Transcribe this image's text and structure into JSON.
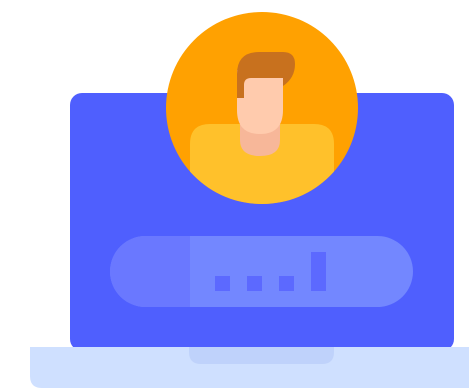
{
  "illustration": {
    "subject": "laptop-user-login",
    "colors": {
      "screen": "#4f5ffe",
      "base": "#cfe0ff",
      "notch": "#bfd2fb",
      "password_field": "#7387ff",
      "password_field_left": "#6a78ff",
      "password_dots": "#5c69ff",
      "avatar_circle": "#ffa101",
      "hair": "#c8711e",
      "face": "#ffcbad",
      "neck": "#f7b799",
      "shirt": "#ffc12b"
    }
  }
}
